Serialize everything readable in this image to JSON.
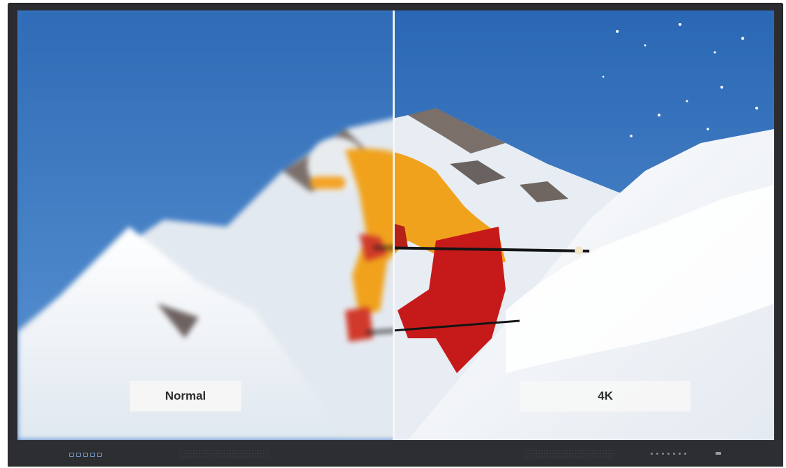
{
  "labels": {
    "normal": "Normal",
    "uhd": "4K"
  },
  "colors": {
    "sky": "#3d79c3",
    "jacket": "#f0a21c",
    "pants": "#c61a1a",
    "snow": "#f2f4f7",
    "bezel": "#2b2c2f"
  },
  "icons": {
    "ports": "usb-port-icon",
    "buttons": "control-button-icon"
  }
}
